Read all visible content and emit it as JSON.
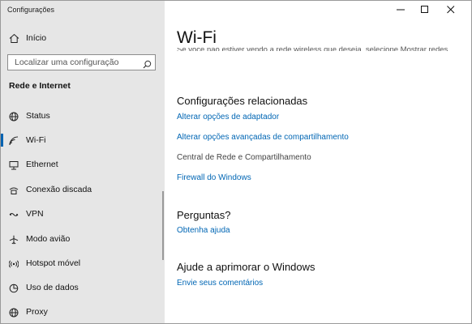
{
  "window": {
    "title": "Configurações"
  },
  "sidebar": {
    "home_label": "Início",
    "search": {
      "placeholder": "Localizar uma configuração"
    },
    "section_header": "Rede e Internet",
    "items": [
      {
        "label": "Status",
        "icon": "globe-icon"
      },
      {
        "label": "Wi-Fi",
        "icon": "wifi-icon",
        "selected": true
      },
      {
        "label": "Ethernet",
        "icon": "ethernet-icon"
      },
      {
        "label": "Conexão discada",
        "icon": "dialup-icon"
      },
      {
        "label": "VPN",
        "icon": "vpn-icon"
      },
      {
        "label": "Modo avião",
        "icon": "airplane-icon"
      },
      {
        "label": "Hotspot móvel",
        "icon": "hotspot-icon"
      },
      {
        "label": "Uso de dados",
        "icon": "data-usage-icon"
      },
      {
        "label": "Proxy",
        "icon": "globe-icon"
      }
    ],
    "accent": "#0063b1"
  },
  "main": {
    "title": "Wi-Fi",
    "intro": "Se você não estiver vendo a rede wireless que deseja, selecione Mostrar redes disponíveis, selecione a que você deseja e selecione Conectar.",
    "related": {
      "title": "Configurações relacionadas",
      "links": [
        "Alterar opções de adaptador",
        "Alterar opções avançadas de compartilhamento",
        "Central de Rede e Compartilhamento",
        "Firewall do Windows"
      ]
    },
    "questions": {
      "title": "Perguntas?",
      "link": "Obtenha ajuda"
    },
    "improve": {
      "title": "Ajude a aprimorar o Windows",
      "link": "Envie seus comentários"
    },
    "link_color": "#0066b4"
  }
}
